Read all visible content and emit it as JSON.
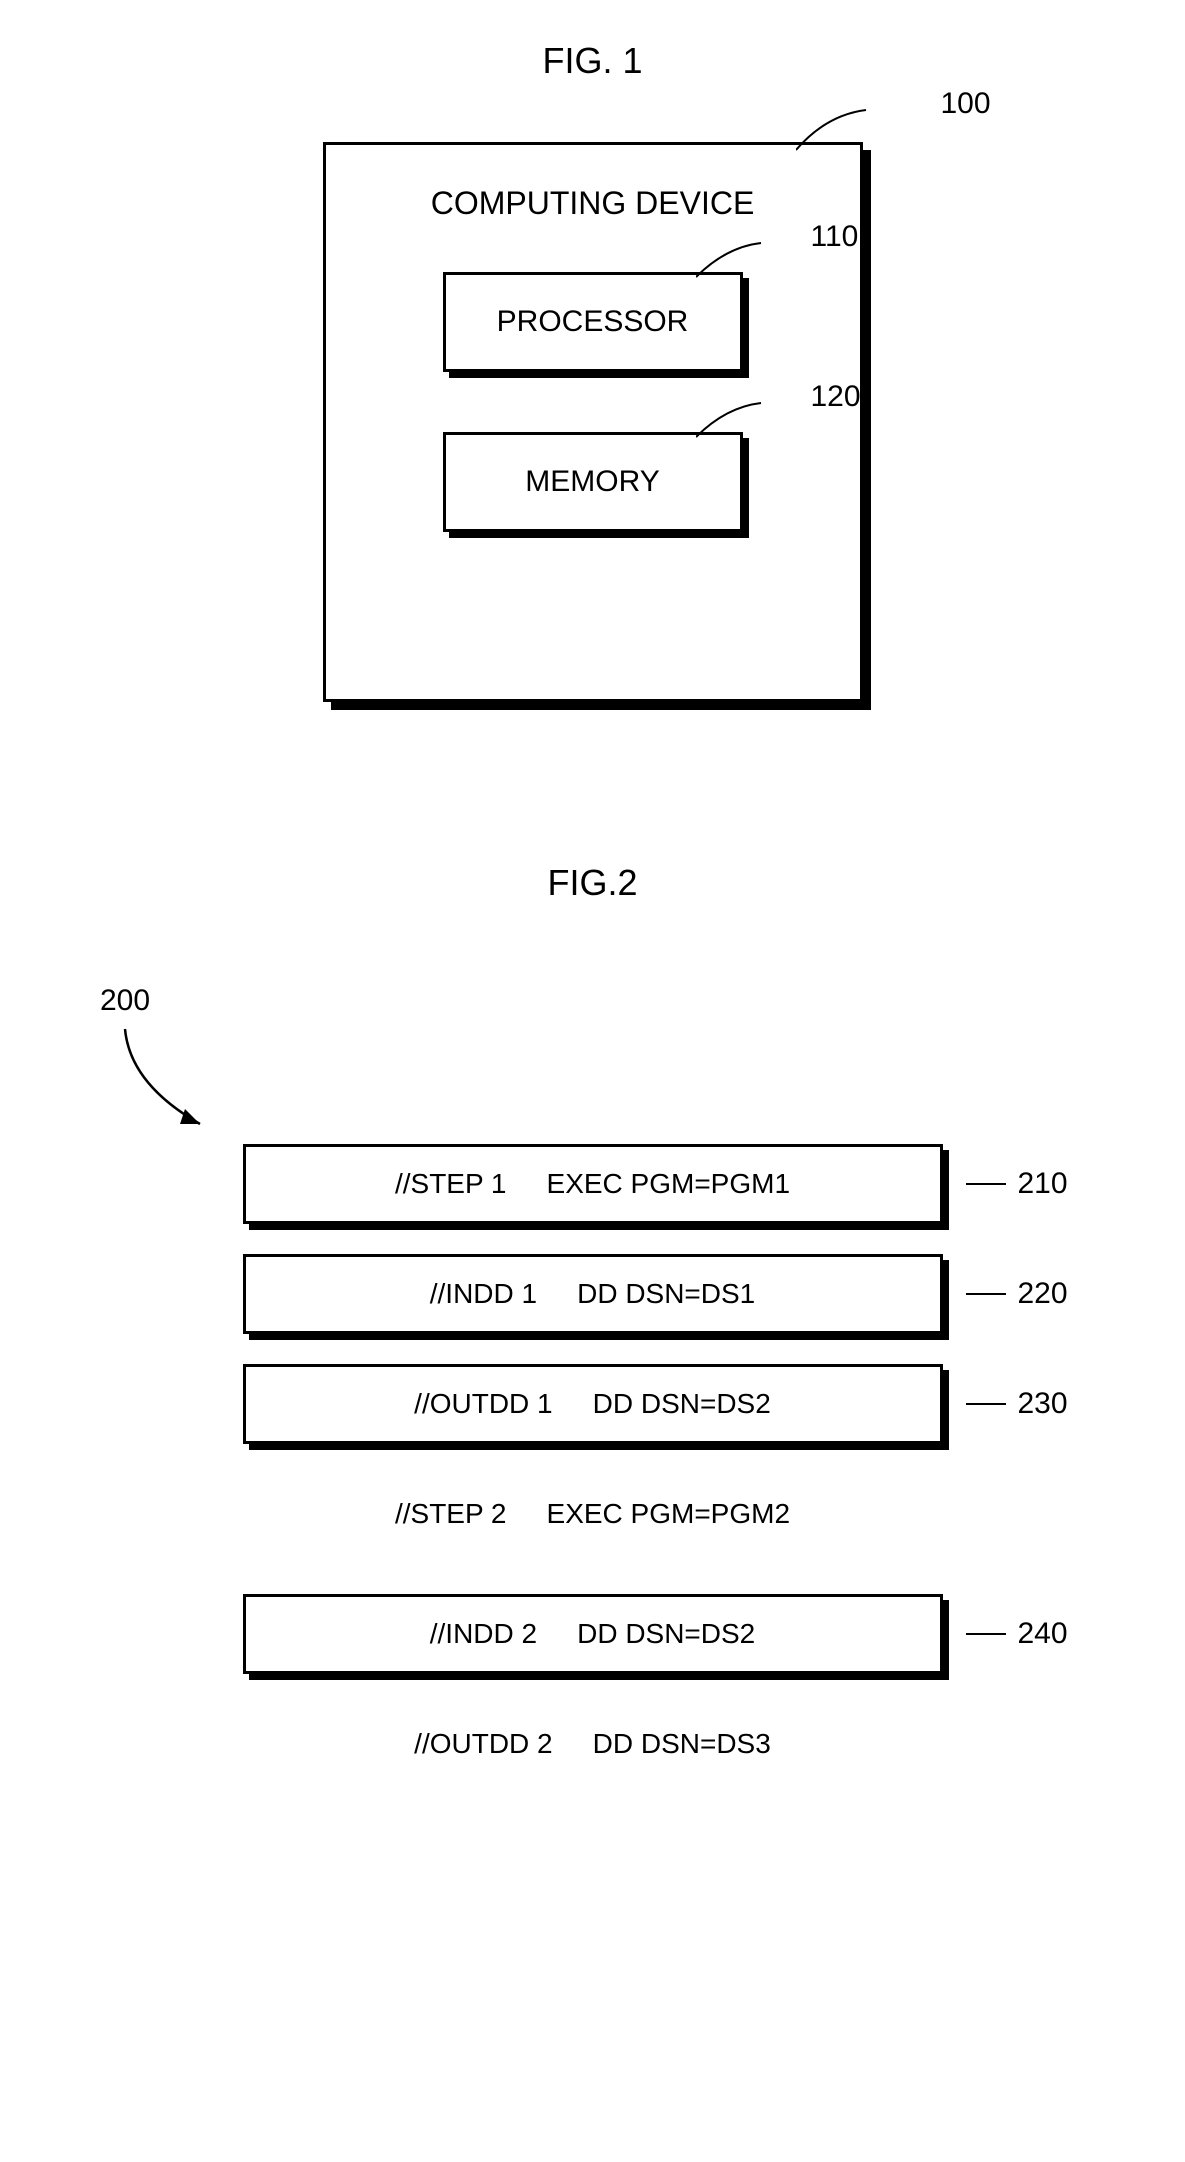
{
  "fig1": {
    "title": "FIG. 1",
    "outer_ref": "100",
    "outer_label": "COMPUTING DEVICE",
    "inner": [
      {
        "ref": "110",
        "label": "PROCESSOR"
      },
      {
        "ref": "120",
        "label": "MEMORY"
      }
    ]
  },
  "fig2": {
    "title": "FIG.2",
    "group_ref": "200",
    "rows": [
      {
        "ref": "210",
        "left": "//STEP 1",
        "right": "EXEC PGM=PGM1",
        "boxed": true
      },
      {
        "ref": "220",
        "left": "//INDD 1",
        "right": "DD DSN=DS1",
        "boxed": true
      },
      {
        "ref": "230",
        "left": "//OUTDD 1",
        "right": "DD DSN=DS2",
        "boxed": true
      },
      {
        "ref": "",
        "left": "//STEP 2",
        "right": "EXEC PGM=PGM2",
        "boxed": false
      },
      {
        "ref": "240",
        "left": "//INDD 2",
        "right": "DD DSN=DS2",
        "boxed": true
      },
      {
        "ref": "",
        "left": "//OUTDD 2",
        "right": "DD DSN=DS3",
        "boxed": false
      }
    ]
  }
}
